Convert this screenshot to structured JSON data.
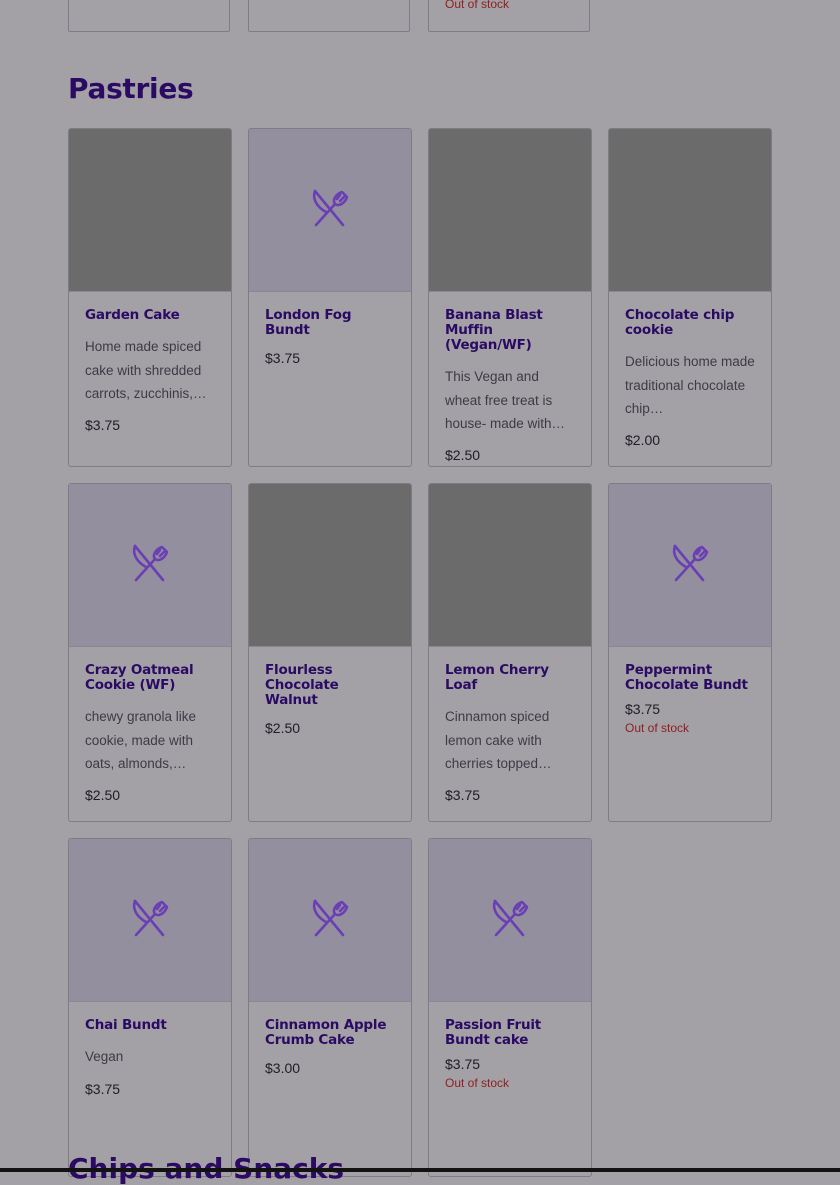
{
  "previous_section": {
    "cards": [
      {
        "out_of_stock": ""
      },
      {
        "out_of_stock": ""
      },
      {
        "out_of_stock": "Out of stock"
      }
    ]
  },
  "section": {
    "title": "Pastries",
    "items": [
      {
        "name": "Garden Cake",
        "description": "Home made spiced cake with shredded carrots, zucchinis,…",
        "price": "$3.75",
        "out_of_stock": "",
        "image": "photo"
      },
      {
        "name": "London Fog Bundt",
        "description": "",
        "price": "$3.75",
        "out_of_stock": "",
        "image": "utensils-icon"
      },
      {
        "name": "Banana Blast Muffin (Vegan/WF)",
        "description": "This Vegan and wheat free treat is house- made with…",
        "price": "$2.50",
        "out_of_stock": "",
        "image": "photo"
      },
      {
        "name": "Chocolate chip cookie",
        "description": "Delicious home made traditional chocolate chip…",
        "price": "$2.00",
        "out_of_stock": "",
        "image": "photo"
      },
      {
        "name": "Crazy Oatmeal Cookie (WF)",
        "description": "chewy granola like cookie, made with oats, almonds,…",
        "price": "$2.50",
        "out_of_stock": "",
        "image": "utensils-icon"
      },
      {
        "name": "Flourless Chocolate Walnut",
        "description": "",
        "price": "$2.50",
        "out_of_stock": "",
        "image": "photo"
      },
      {
        "name": "Lemon Cherry Loaf",
        "description": "Cinnamon spiced lemon cake with cherries topped…",
        "price": "$3.75",
        "out_of_stock": "",
        "image": "photo"
      },
      {
        "name": "Peppermint Chocolate Bundt",
        "description": "",
        "price": "$3.75",
        "out_of_stock": "Out of stock",
        "image": "utensils-icon"
      },
      {
        "name": "Chai Bundt",
        "description": "Vegan",
        "price": "$3.75",
        "out_of_stock": "",
        "image": "utensils-icon"
      },
      {
        "name": "Cinnamon Apple Crumb Cake",
        "description": "",
        "price": "$3.00",
        "out_of_stock": "",
        "image": "utensils-icon"
      },
      {
        "name": "Passion Fruit Bundt cake",
        "description": "",
        "price": "$3.75",
        "out_of_stock": "Out of stock",
        "image": "utensils-icon"
      }
    ]
  },
  "next_section": {
    "title": "Chips and Snacks"
  },
  "colors": {
    "accent": "#2a0a63",
    "icon": "#6a3fb5",
    "out_of_stock": "#8e1e1e",
    "overlay": "#a3a1a6"
  }
}
